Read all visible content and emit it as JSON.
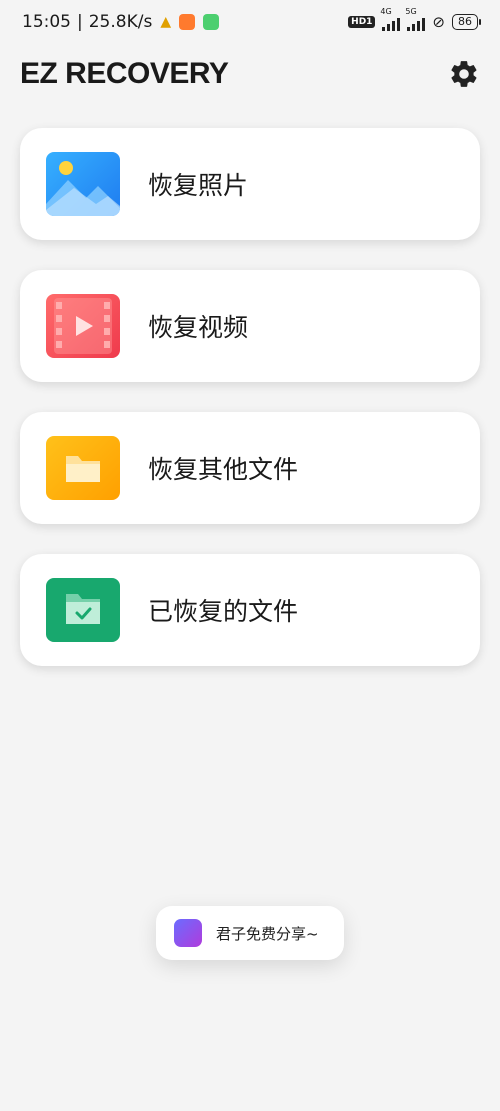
{
  "status_bar": {
    "time": "15:05",
    "separator": "|",
    "net_speed": "25.8K/s",
    "hd_badge": "HD1",
    "net_4g": "4G",
    "net_5g": "5G",
    "battery": "86"
  },
  "header": {
    "title": "EZ RECOVERY"
  },
  "menu": [
    {
      "label": "恢复照片",
      "icon": "photo-icon"
    },
    {
      "label": "恢复视频",
      "icon": "video-icon"
    },
    {
      "label": "恢复其他文件",
      "icon": "folder-icon"
    },
    {
      "label": "已恢复的文件",
      "icon": "recovered-folder-icon"
    }
  ],
  "toast": {
    "text": "君子免费分享~"
  },
  "colors": {
    "background": "#f4f4f4",
    "photo": "#2f9bf7",
    "video": "#f54b55",
    "folder": "#ffb10a",
    "recovered": "#18a86e"
  }
}
